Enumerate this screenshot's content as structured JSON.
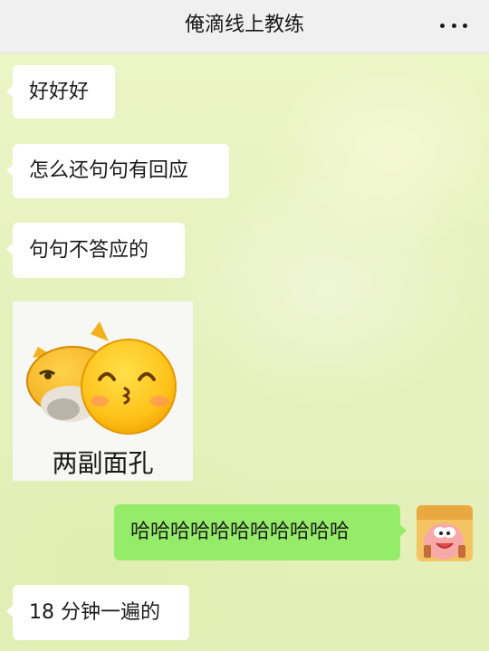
{
  "header": {
    "title": "俺滴线上教练",
    "more_icon": "more-dots-icon"
  },
  "messages": [
    {
      "side": "left",
      "text": "好好好"
    },
    {
      "side": "left",
      "text": "怎么还句句有回应"
    },
    {
      "side": "left",
      "text": "句句不答应的"
    },
    {
      "side": "left",
      "type": "sticker",
      "caption": "两副面孔"
    },
    {
      "side": "right",
      "text": "哈哈哈哈哈哈哈哈哈哈哈"
    },
    {
      "side": "left",
      "text": "18 分钟一遍的"
    }
  ],
  "colors": {
    "self_bubble": "#95ec69",
    "other_bubble": "#ffffff",
    "header_bg": "#f0f0f0"
  }
}
